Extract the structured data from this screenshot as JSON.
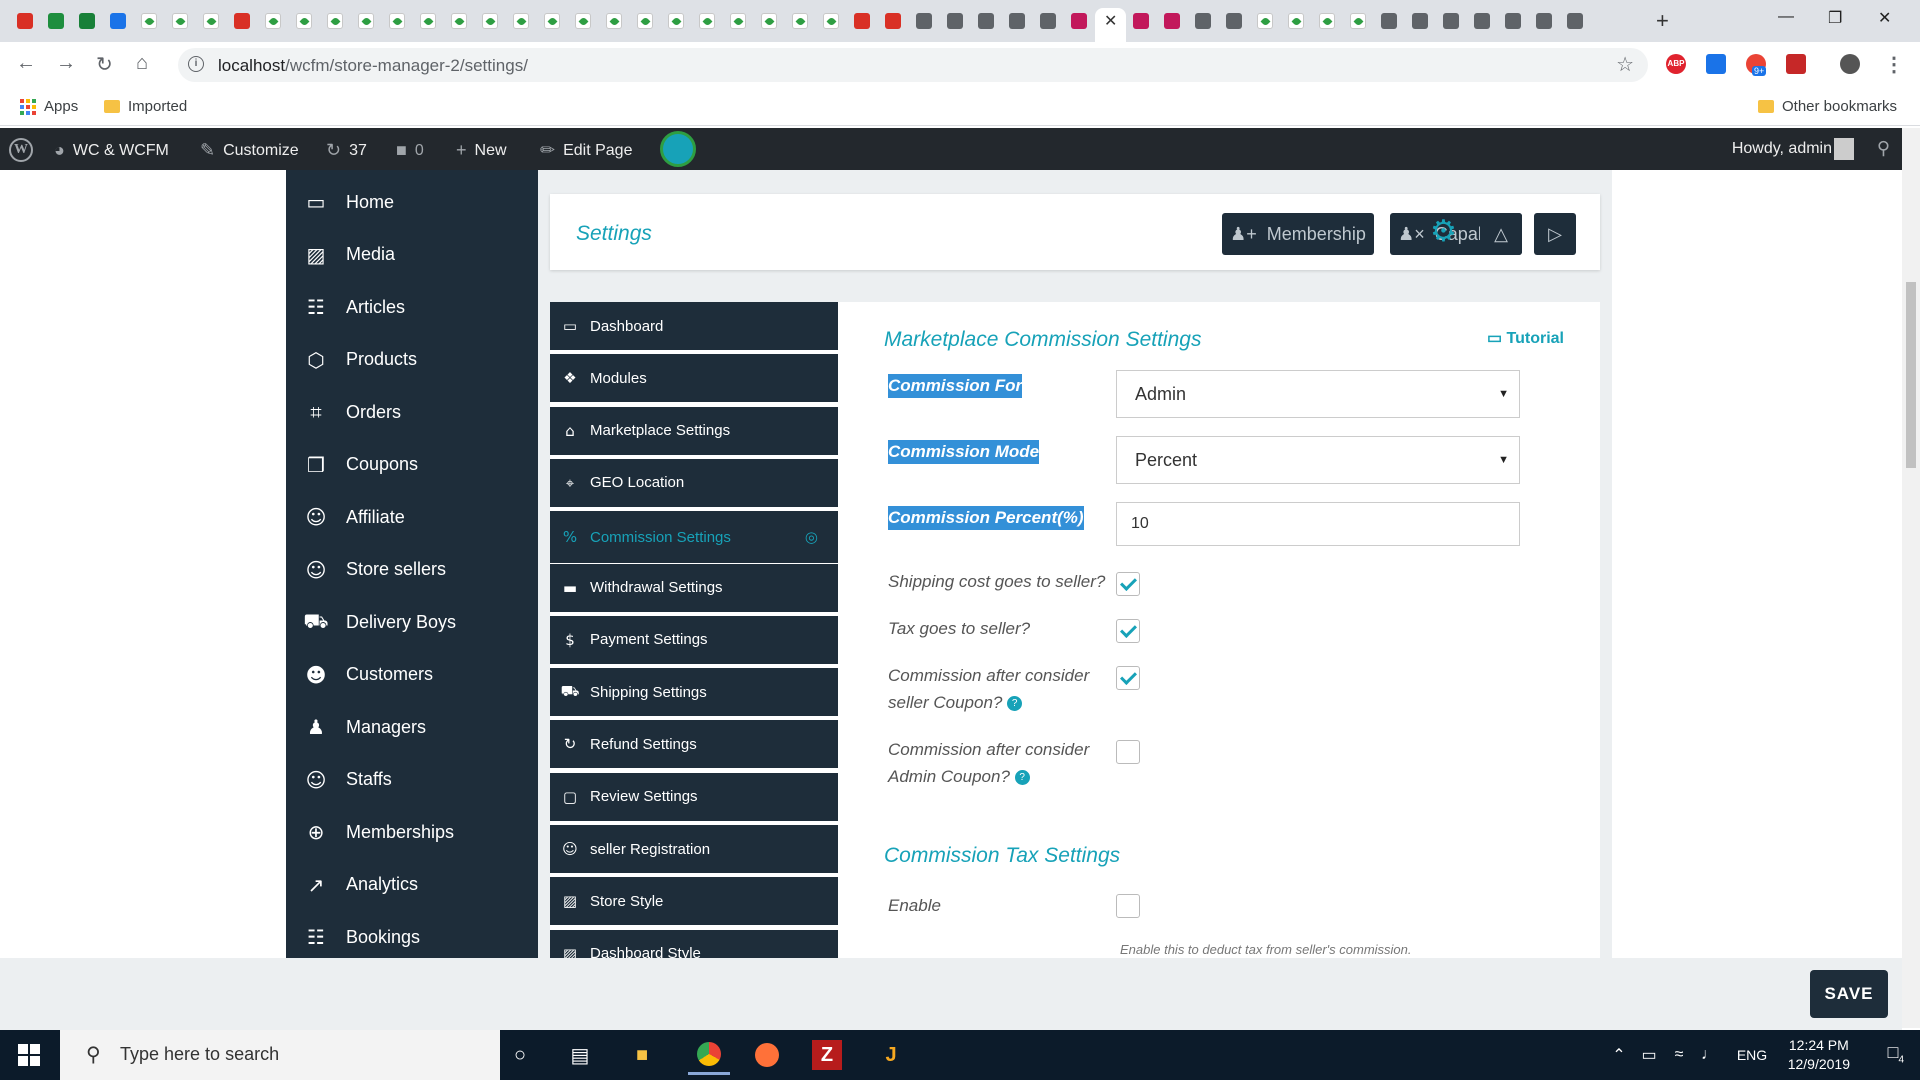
{
  "browser": {
    "url_host": "localhost",
    "url_path": "/wcfm/store-manager-2/settings/",
    "bookmarks": [
      "Apps",
      "Imported"
    ],
    "other_bookmarks": "Other bookmarks",
    "abp_label": "ABP",
    "ext_badge": "9+"
  },
  "wpbar": {
    "site_name": "WC & WCFM",
    "customize": "Customize",
    "updates_count": "37",
    "comments_count": "0",
    "new_label": "New",
    "edit_page": "Edit Page",
    "howdy": "Howdy, admin"
  },
  "sidebar": {
    "items": [
      {
        "label": "Home",
        "icon": "monitor-icon"
      },
      {
        "label": "Media",
        "icon": "image-icon"
      },
      {
        "label": "Articles",
        "icon": "document-icon"
      },
      {
        "label": "Products",
        "icon": "cube-icon"
      },
      {
        "label": "Orders",
        "icon": "cart-icon"
      },
      {
        "label": "Coupons",
        "icon": "gift-icon"
      },
      {
        "label": "Affiliate",
        "icon": "users-icon"
      },
      {
        "label": "Store sellers",
        "icon": "user-icon"
      },
      {
        "label": "Delivery Boys",
        "icon": "truck-icon"
      },
      {
        "label": "Customers",
        "icon": "user-circle-icon"
      },
      {
        "label": "Managers",
        "icon": "user-tie-icon"
      },
      {
        "label": "Staffs",
        "icon": "user-icon"
      },
      {
        "label": "Memberships",
        "icon": "user-plus-icon"
      },
      {
        "label": "Analytics",
        "icon": "chart-icon"
      },
      {
        "label": "Bookings",
        "icon": "calendar-icon"
      }
    ]
  },
  "header": {
    "title": "Settings",
    "membership_label": "Membership",
    "capability_label": "Capability"
  },
  "submenu": {
    "items": [
      {
        "label": "Dashboard",
        "icon": "monitor-icon"
      },
      {
        "label": "Modules",
        "icon": "puzzle-icon"
      },
      {
        "label": "Marketplace Settings",
        "icon": "home-icon"
      },
      {
        "label": "GEO Location",
        "icon": "map-pin-icon"
      },
      {
        "label": "Commission Settings",
        "icon": "percent-icon",
        "active": true
      },
      {
        "label": "Withdrawal Settings",
        "icon": "credit-card-icon"
      },
      {
        "label": "Payment Settings",
        "icon": "dollar-icon"
      },
      {
        "label": "Shipping Settings",
        "icon": "truck-icon"
      },
      {
        "label": "Refund Settings",
        "icon": "refresh-icon"
      },
      {
        "label": "Review Settings",
        "icon": "comment-icon"
      },
      {
        "label": "seller Registration",
        "icon": "user-icon"
      },
      {
        "label": "Store Style",
        "icon": "image-icon"
      },
      {
        "label": "Dashboard Style",
        "icon": "image-icon"
      }
    ]
  },
  "form": {
    "section_title": "Marketplace Commission Settings",
    "tutorial_label": "Tutorial",
    "commission_for_label": "Commission For",
    "commission_for_value": "Admin",
    "commission_mode_label": "Commission Mode",
    "commission_mode_value": "Percent",
    "commission_percent_label": "Commission Percent(%)",
    "commission_percent_value": "10",
    "shipping_label": "Shipping cost goes to seller?",
    "tax_label": "Tax goes to seller?",
    "seller_coupon_line1": "Commission after consider",
    "seller_coupon_line2": "seller Coupon?",
    "admin_coupon_line1": "Commission after consider",
    "admin_coupon_line2": "Admin Coupon?",
    "help_glyph": "?",
    "checks": {
      "shipping": true,
      "tax": true,
      "seller_coupon": true,
      "admin_coupon": false,
      "tax_enable": false
    },
    "tax_section_title": "Commission Tax Settings",
    "enable_label": "Enable",
    "enable_note": "Enable this to deduct tax from seller's commission."
  },
  "footer": {
    "save_label": "SAVE"
  },
  "taskbar": {
    "search_placeholder": "Type here to search",
    "lang": "ENG",
    "time": "12:24 PM",
    "date": "12/9/2019",
    "notif_count": "4"
  },
  "colors": {
    "accent": "#17a2b8",
    "nav_bg": "#1e2d3a",
    "highlight": "#3390d8"
  }
}
